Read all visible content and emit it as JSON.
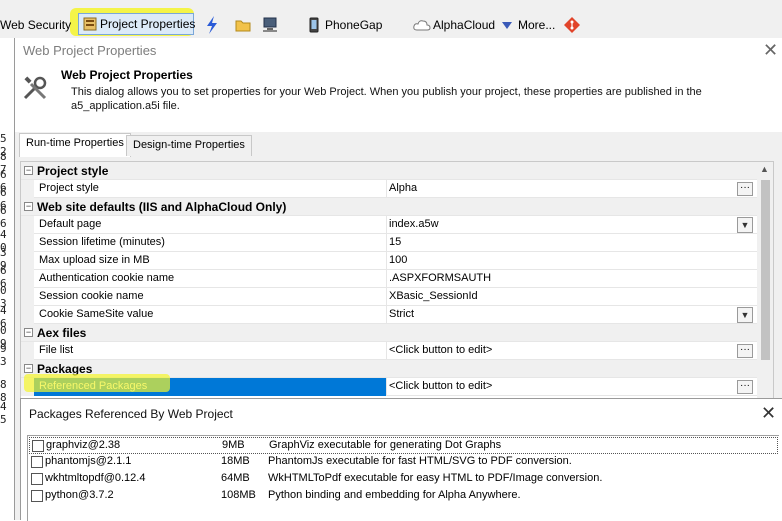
{
  "toolbar": {
    "web_security": "Web Security",
    "project_properties": "Project Properties",
    "phonegap": "PhoneGap",
    "alphacloud": "AlphaCloud",
    "more": "More..."
  },
  "gutter": [
    "5 2",
    "8 7",
    "6 6",
    "6 6",
    "6 6",
    "4 0",
    "3 9",
    "6 6",
    "0 3",
    "4 6",
    "0 9",
    "9 3",
    "8 8",
    "4 5"
  ],
  "dialog": {
    "title": "Web Project Properties",
    "heading": "Web Project Properties",
    "description": "This dialog allows you to set properties for your Web Project. When you publish your project, these properties are published in the a5_application.a5i file.",
    "tabs": [
      "Run-time Properties",
      "Design-time Properties"
    ],
    "grid": [
      {
        "kind": "section",
        "label": "Project style"
      },
      {
        "kind": "prop",
        "label": "Project style",
        "value": "Alpha",
        "button": "ellipsis"
      },
      {
        "kind": "section",
        "label": "Web site defaults (IIS and AlphaCloud Only)"
      },
      {
        "kind": "prop",
        "label": "Default page",
        "value": "index.a5w",
        "button": "dropdown"
      },
      {
        "kind": "prop",
        "label": "Session lifetime (minutes)",
        "value": "15",
        "button": ""
      },
      {
        "kind": "prop",
        "label": "Max upload size in MB",
        "value": "100",
        "button": ""
      },
      {
        "kind": "prop",
        "label": "Authentication cookie name",
        "value": ".ASPXFORMSAUTH",
        "button": ""
      },
      {
        "kind": "prop",
        "label": "Session cookie name",
        "value": "XBasic_SessionId",
        "button": ""
      },
      {
        "kind": "prop",
        "label": "Cookie SameSite value",
        "value": "Strict",
        "button": "dropdown"
      },
      {
        "kind": "section",
        "label": "Aex files"
      },
      {
        "kind": "prop",
        "label": "File list",
        "value": "<Click button to edit>",
        "button": "ellipsis"
      },
      {
        "kind": "section",
        "label": "Packages"
      },
      {
        "kind": "prop",
        "label": "Referenced Packages",
        "value": "<Click button to edit>",
        "button": "ellipsis",
        "selected": true
      }
    ]
  },
  "packages": {
    "title": "Packages Referenced By Web Project",
    "items": [
      {
        "name": "graphviz@2.38",
        "size": "9MB",
        "desc": "GraphViz executable for generating Dot Graphs"
      },
      {
        "name": "phantomjs@2.1.1",
        "size": "18MB",
        "desc": "PhantomJs executable for fast HTML/SVG to PDF conversion."
      },
      {
        "name": "wkhtmltopdf@0.12.4",
        "size": "64MB",
        "desc": "WkHTMLToPdf executable for easy HTML to PDF/Image conversion."
      },
      {
        "name": "python@3.7.2",
        "size": "108MB",
        "desc": "Python binding and embedding for Alpha Anywhere."
      }
    ]
  },
  "colors": {
    "highlight": "#f5f52a",
    "selection": "#0078d7",
    "toolbar_bg": "#f0f0f0"
  }
}
